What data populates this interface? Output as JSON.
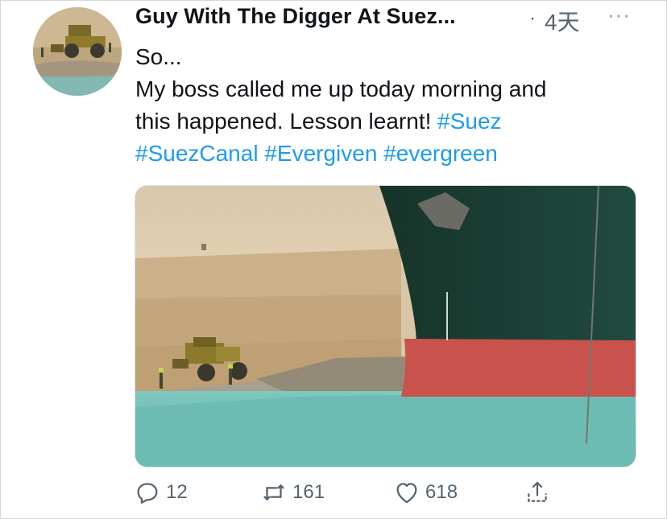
{
  "tweet": {
    "author_name": "Guy With The Digger At Suez...",
    "separator": "·",
    "time": "4天",
    "more": "···",
    "text_lines": [
      [
        {
          "t": "So...",
          "tag": false
        }
      ],
      [
        {
          "t": "My boss called me up today morning and",
          "tag": false
        }
      ],
      [
        {
          "t": "this happened. Lesson learnt! ",
          "tag": false
        },
        {
          "t": "#Suez",
          "tag": true
        }
      ],
      [
        {
          "t": "#SuezCanal",
          "tag": true
        },
        {
          "t": " ",
          "tag": false
        },
        {
          "t": "#Evergiven",
          "tag": true
        },
        {
          "t": " ",
          "tag": false
        },
        {
          "t": "#evergreen",
          "tag": true
        }
      ]
    ]
  },
  "actions": {
    "reply_count": "12",
    "retweet_count": "161",
    "like_count": "618"
  },
  "icons": {
    "reply": "reply-icon",
    "retweet": "retweet-icon",
    "like": "heart-icon",
    "share": "share-icon"
  },
  "colors": {
    "hashtag": "#1d9bf0",
    "secondary_text": "#536471",
    "ship_hull": "#1d3d36",
    "ship_bottom": "#c8504a",
    "water": "#6cc0b8"
  }
}
